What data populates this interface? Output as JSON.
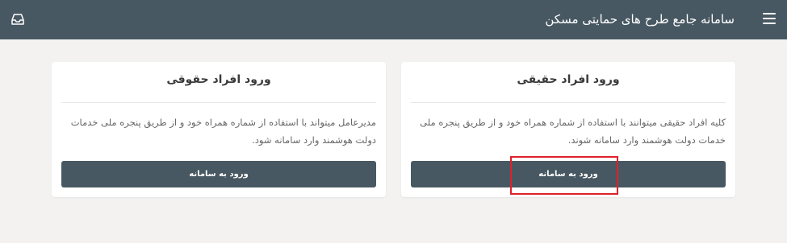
{
  "header": {
    "title": "سامانه جامع طرح های حمایتی مسکن"
  },
  "cards": {
    "real": {
      "title": "ورود افراد حقیقی",
      "description": "کلیه افراد حقیقی میتوانند با استفاده از شماره همراه خود و از طریق پنجره ملی خدمات دولت هوشمند وارد سامانه شوند.",
      "button_label": "ورود به سامانه"
    },
    "legal": {
      "title": "ورود افراد حقوقی",
      "description": "مدیرعامل میتواند با استفاده از شماره همراه خود و از طریق پنجره ملی خدمات دولت هوشمند وارد سامانه شود.",
      "button_label": "ورود به سامانه"
    }
  },
  "colors": {
    "header_bg": "#485862",
    "button_bg": "#485862",
    "highlight_border": "#e0202a",
    "page_bg": "#f3f2f1"
  },
  "icons": {
    "menu": "hamburger-menu-icon",
    "inbox": "inbox-icon"
  }
}
